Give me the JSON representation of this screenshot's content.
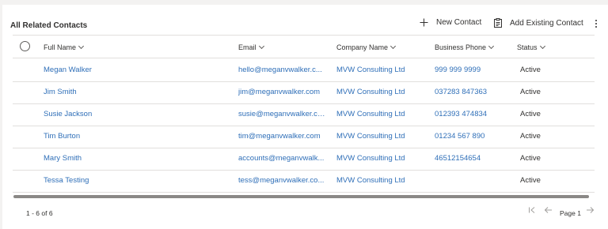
{
  "subgrid": {
    "title": "All Related Contacts",
    "commands": {
      "new_contact": "New Contact",
      "add_existing": "Add Existing Contact"
    },
    "columns": {
      "full_name": "Full Name",
      "email": "Email",
      "company": "Company Name",
      "phone": "Business Phone",
      "status": "Status"
    },
    "rows": [
      {
        "name": "Megan Walker",
        "email": "hello@meganvwalker.c...",
        "company": "MVW Consulting Ltd",
        "phone": "999 999 9999",
        "status": "Active"
      },
      {
        "name": "Jim Smith",
        "email": "jim@meganvwalker.com",
        "company": "MVW Consulting Ltd",
        "phone": "037283 847363",
        "status": "Active"
      },
      {
        "name": "Susie Jackson",
        "email": "susie@meganvwalker.co...",
        "company": "MVW Consulting Ltd",
        "phone": "012393 474834",
        "status": "Active"
      },
      {
        "name": "Tim Burton",
        "email": "tim@meganvwalker.com",
        "company": "MVW Consulting Ltd",
        "phone": "01234 567 890",
        "status": "Active"
      },
      {
        "name": "Mary Smith",
        "email": "accounts@meganvwalk...",
        "company": "MVW Consulting Ltd",
        "phone": "46512154654",
        "status": "Active"
      },
      {
        "name": "Tessa Testing",
        "email": "tess@meganvwalker.co...",
        "company": "MVW Consulting Ltd",
        "phone": "",
        "status": "Active"
      }
    ],
    "footer": {
      "record_count": "1 - 6 of 6",
      "page_label": "Page 1"
    },
    "colors": {
      "link": "#2f6fb8",
      "text": "#323130",
      "border": "#e1dfdd"
    }
  }
}
